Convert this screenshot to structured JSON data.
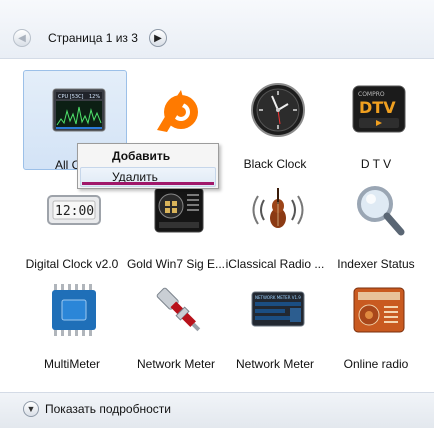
{
  "pager": {
    "prev_icon": "chevron-left-icon",
    "label": "Страница 1 из 3",
    "next_icon": "chevron-right-icon"
  },
  "gadgets": [
    {
      "label": "All CPU",
      "icon": "cpu-meter-icon",
      "selected": true
    },
    {
      "label": "",
      "icon": "avast-icon"
    },
    {
      "label": "Black Clock",
      "icon": "black-clock-icon"
    },
    {
      "label": "D T V",
      "icon": "dtv-icon"
    },
    {
      "label": "Digital Clock v2.0",
      "icon": "digital-clock-icon"
    },
    {
      "label": "Gold Win7 Sig E...",
      "icon": "gold-win7-icon"
    },
    {
      "label": "iClassical Radio ...",
      "icon": "violin-icon"
    },
    {
      "label": "Indexer Status",
      "icon": "magnifier-icon"
    },
    {
      "label": "MultiMeter",
      "icon": "chip-icon"
    },
    {
      "label": "Network Meter",
      "icon": "network-plug-icon"
    },
    {
      "label": "Network Meter",
      "icon": "network-meter-panel-icon"
    },
    {
      "label": "Online radio",
      "icon": "radio-icon"
    }
  ],
  "context_menu": {
    "add": "Добавить",
    "remove": "Удалить"
  },
  "footer": {
    "details_label": "Показать подробности",
    "details_icon": "chevron-down-icon"
  },
  "cpu_gadget": {
    "title": "CPU [53C]",
    "percent": "12%"
  },
  "clock_gadget": {
    "time": "12:00"
  },
  "dtv_gadget": {
    "brand": "COMPRO",
    "name": "DTV"
  },
  "netmeter_gadget": {
    "title": "NETWORK METER V1.9"
  }
}
